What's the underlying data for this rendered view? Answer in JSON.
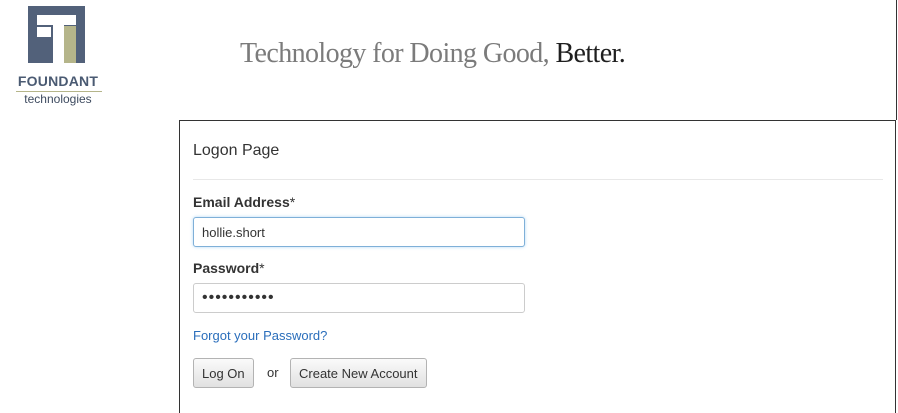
{
  "header": {
    "logo": {
      "brand": "FOUNDANT",
      "sub": "technologies"
    },
    "tagline": {
      "main": "Technology for Doing Good,",
      "emphasis": "Better."
    }
  },
  "logon": {
    "title": "Logon Page",
    "email": {
      "label": "Email Address",
      "required_mark": "*",
      "value": "hollie.short"
    },
    "password": {
      "label": "Password",
      "required_mark": "*",
      "value": "hollieshort"
    },
    "forgot_link": "Forgot your Password?",
    "logon_button": "Log On",
    "or_text": "or",
    "create_account_button": "Create New Account"
  },
  "colors": {
    "brand_navy": "#4a5a72",
    "brand_olive": "#b5b58a",
    "link": "#2a6ebb",
    "focus_border": "#7fb0d8"
  }
}
